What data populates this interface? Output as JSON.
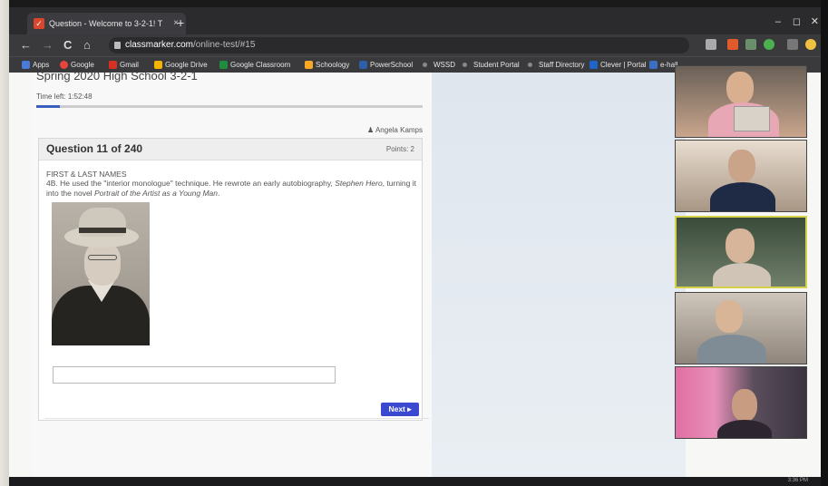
{
  "browser": {
    "tab_title": "Question - Welcome to 3-2-1! T",
    "tab_close": "×",
    "new_tab": "+",
    "url_host": "classmarker.com",
    "url_path": "/online-test/#15",
    "window_controls": {
      "minimize": "–",
      "maximize": "◻",
      "close": "✕"
    },
    "nav": {
      "back": "←",
      "forward": "→",
      "reload": "C",
      "home": "⌂"
    },
    "bookmarks": [
      {
        "label": "Apps",
        "color": "#4a7bd8"
      },
      {
        "label": "Google",
        "color": "#e8453c"
      },
      {
        "label": "Gmail",
        "color": "#d93025"
      },
      {
        "label": "Google Drive",
        "color": "#f4b400"
      },
      {
        "label": "Google Classroom",
        "color": "#1e8e3e"
      },
      {
        "label": "Schoology",
        "color": "#f9a825"
      },
      {
        "label": "PowerSchool",
        "color": "#2f5fa8"
      },
      {
        "label": "WSSD",
        "color": "#888888"
      },
      {
        "label": "Student Portal",
        "color": "#888888"
      },
      {
        "label": "Staff Directory",
        "color": "#888888"
      },
      {
        "label": "Clever | Portal",
        "color": "#1f64c8"
      },
      {
        "label": "e-hall",
        "color": "#3a6fc4"
      }
    ]
  },
  "quiz": {
    "title": "Spring 2020 High School 3-2-1",
    "time_left": "Time left: 1:52:48",
    "progress": 0.06,
    "user": "Angela Kamps",
    "question_number": "Question 11 of 240",
    "points": "Points: 2",
    "heading": "FIRST & LAST NAMES",
    "text_prefix": "4B. He used the \"interior monologue\" technique. He rewrote an early autobiography, ",
    "text_italic1": "Stephen Hero",
    "text_mid": ", turning it into the novel ",
    "text_italic2": "Portrait of the Artist as a Young Man",
    "text_suffix": ".",
    "answer_value": "",
    "next_label": "Next ▸"
  },
  "taskbar": {
    "clock": "3:36 PM"
  },
  "colors": {
    "accent": "#3b48d0",
    "progress": "#3a5fbf"
  }
}
